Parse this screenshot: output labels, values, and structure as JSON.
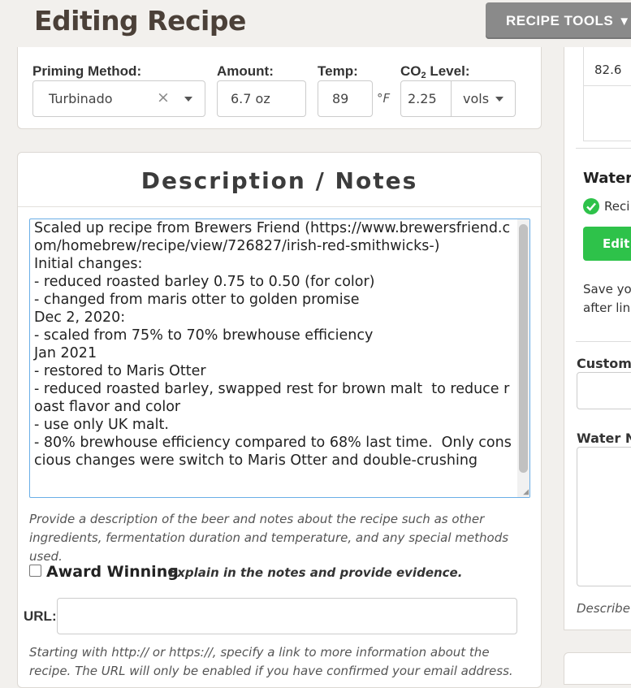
{
  "header": {
    "title": "Editing Recipe",
    "tools_button": "RECIPE TOOLS",
    "tools_caret": "▼"
  },
  "priming": {
    "method_label": "Priming Method:",
    "method_value": "Turbinado",
    "clear_glyph": "×",
    "amount_label": "Amount:",
    "amount_value": "6.7 oz",
    "temp_label": "Temp:",
    "temp_value": "89",
    "temp_unit": "°F",
    "co2_label_prefix": "CO",
    "co2_label_sub": "2",
    "co2_label_suffix": " Level:",
    "co2_value": "2.25",
    "co2_unit": "vols"
  },
  "description": {
    "title": "Description / Notes",
    "notes": "Scaled up recipe from Brewers Friend (https://www.brewersfriend.com/homebrew/recipe/view/726827/irish-red-smithwicks-)\nInitial changes:\n- reduced roasted barley 0.75 to 0.50 (for color)\n- changed from maris otter to golden promise\nDec 2, 2020:\n- scaled from 75% to 70% brewhouse efficiency\nJan 2021\n- restored to Maris Otter\n- reduced roasted barley, swapped rest for brown malt  to reduce roast flavor and color\n- use only UK malt.\n- 80% brewhouse efficiency compared to 68% last time.  Only conscious changes were switch to Maris Otter and double-crushing",
    "help_text": "Provide a description of the beer and notes about the recipe such as other ingredients, fermentation duration and temperature, and any special methods used.",
    "award_label": "Award Winning",
    "award_note": "Explain in the notes and provide evidence.",
    "url_label": "URL:",
    "url_value": "",
    "url_help": "Starting with http:// or https://, specify a link to more information about the recipe. The URL will only be enabled if you have confirmed your email address."
  },
  "right": {
    "value_cell": "82.6",
    "water_heading": "Water",
    "status_text": "Reci",
    "edit_button": "Edit",
    "save_line1": "Save yo",
    "save_line2": "after lin",
    "custom_label": "Custom",
    "water_notes_label": "Water N",
    "describe_text": "Describe"
  },
  "colors": {
    "accent_green": "#2ec24a",
    "tools_button_bg": "#8a8a8a",
    "textarea_focus": "#6aaee6"
  }
}
